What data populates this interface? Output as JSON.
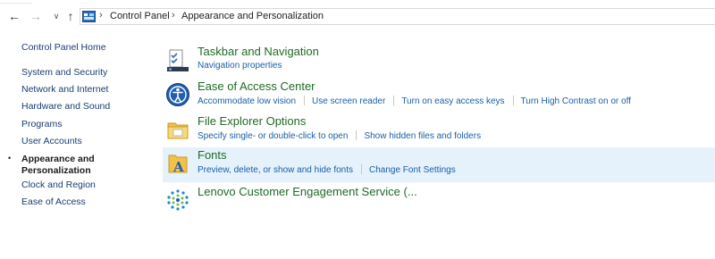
{
  "address_bar": {
    "crumbs": [
      "Control Panel",
      "Appearance and Personalization"
    ]
  },
  "sidebar": {
    "home": "Control Panel Home",
    "items": [
      "System and Security",
      "Network and Internet",
      "Hardware and Sound",
      "Programs",
      "User Accounts",
      "Appearance and Personalization",
      "Clock and Region",
      "Ease of Access"
    ],
    "active_index": 5,
    "bullet": "•"
  },
  "categories": [
    {
      "title": "Taskbar and Navigation",
      "icon": "taskbar-icon",
      "links": [
        "Navigation properties"
      ]
    },
    {
      "title": "Ease of Access Center",
      "icon": "ease-of-access-icon",
      "links": [
        "Accommodate low vision",
        "Use screen reader",
        "Turn on easy access keys",
        "Turn High Contrast on or off"
      ]
    },
    {
      "title": "File Explorer Options",
      "icon": "folder-options-icon",
      "links": [
        "Specify single- or double-click to open",
        "Show hidden files and folders"
      ]
    },
    {
      "title": "Fonts",
      "icon": "fonts-icon",
      "links": [
        "Preview, delete, or show and hide fonts",
        "Change Font Settings"
      ],
      "highlighted": true
    },
    {
      "title": "Lenovo Customer Engagement Service  (...",
      "icon": "lenovo-service-icon",
      "links": []
    }
  ],
  "colors": {
    "category_title": "#1e6b24",
    "link": "#1a5fa8",
    "sidebar_link": "#1a3c72",
    "highlight_row": "#e5f1fb"
  }
}
